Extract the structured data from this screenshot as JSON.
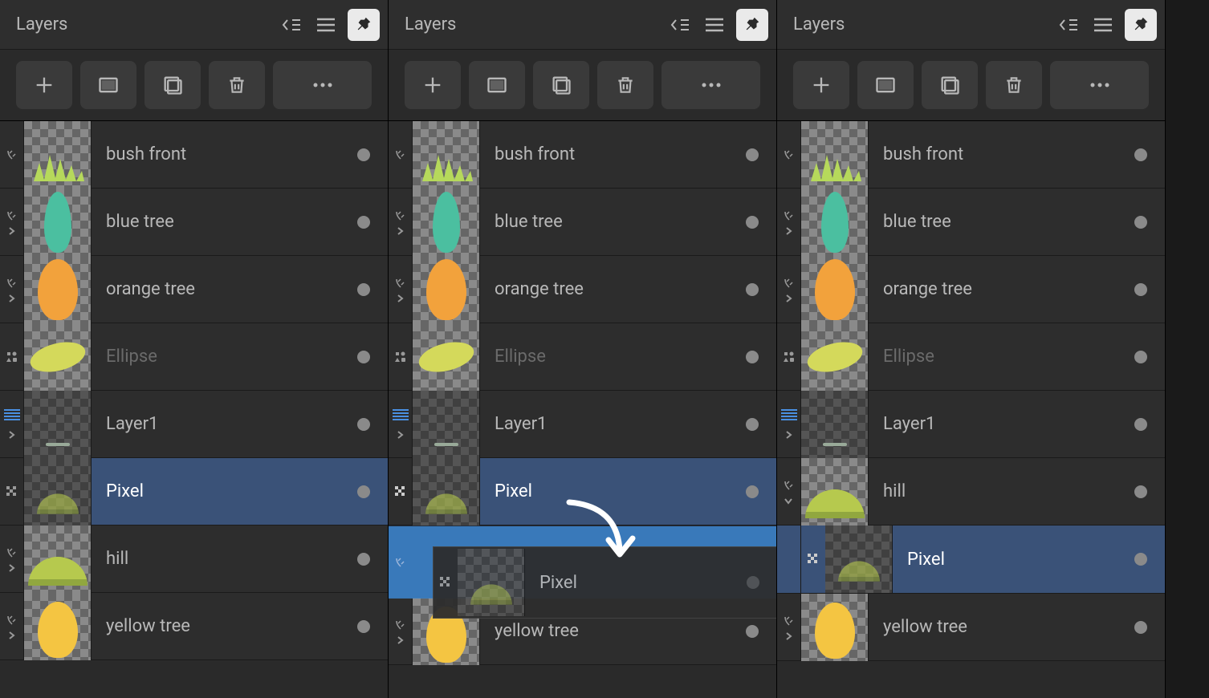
{
  "panels": [
    {
      "title": "Layers",
      "layers": [
        {
          "name": "bush front",
          "type": "vector"
        },
        {
          "name": "blue tree",
          "type": "vector"
        },
        {
          "name": "orange tree",
          "type": "vector"
        },
        {
          "name": "Ellipse",
          "type": "shape",
          "dimmed": true
        },
        {
          "name": "Layer1",
          "type": "pixel"
        },
        {
          "name": "Pixel",
          "type": "pixel",
          "selected": true
        },
        {
          "name": "hill",
          "type": "vector"
        },
        {
          "name": "yellow tree",
          "type": "vector"
        }
      ]
    },
    {
      "title": "Layers",
      "layers": [
        {
          "name": "bush front",
          "type": "vector"
        },
        {
          "name": "blue tree",
          "type": "vector"
        },
        {
          "name": "orange tree",
          "type": "vector"
        },
        {
          "name": "Ellipse",
          "type": "shape",
          "dimmed": true
        },
        {
          "name": "Layer1",
          "type": "pixel"
        },
        {
          "name": "Pixel",
          "type": "pixel",
          "selected": true
        },
        {
          "name": "yellow tree",
          "type": "vector"
        }
      ],
      "drag": {
        "label": "Pixel"
      }
    },
    {
      "title": "Layers",
      "layers": [
        {
          "name": "bush front",
          "type": "vector"
        },
        {
          "name": "blue tree",
          "type": "vector"
        },
        {
          "name": "orange tree",
          "type": "vector"
        },
        {
          "name": "Ellipse",
          "type": "shape",
          "dimmed": true
        },
        {
          "name": "Layer1",
          "type": "pixel"
        },
        {
          "name": "hill",
          "type": "vector",
          "expanded": true
        },
        {
          "name": "Pixel",
          "type": "pixel",
          "selected": true,
          "nested": true
        },
        {
          "name": "yellow tree",
          "type": "vector"
        }
      ]
    }
  ],
  "toolbar_icons": [
    "add",
    "mask",
    "folder",
    "delete",
    "more"
  ]
}
